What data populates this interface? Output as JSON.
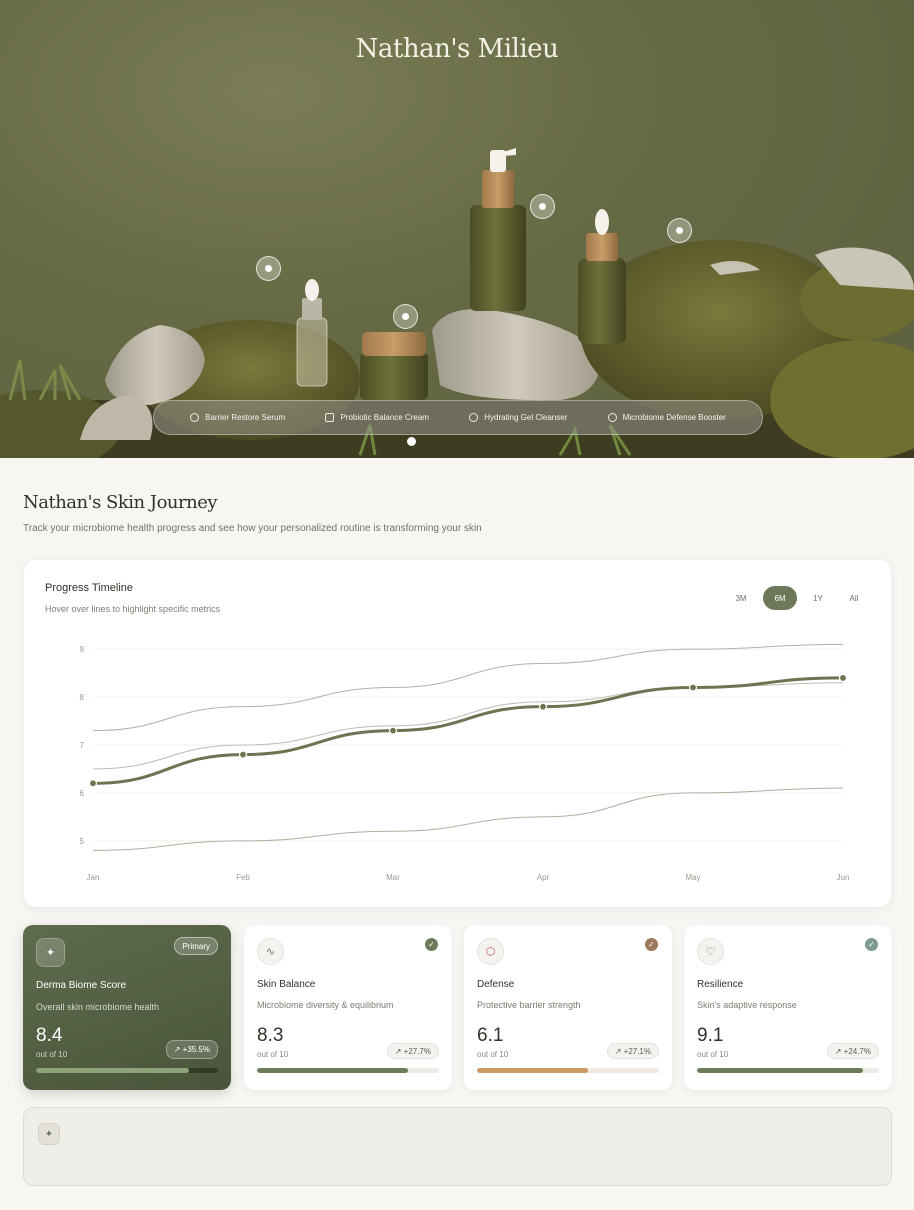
{
  "hero": {
    "brand": "Nathan's Milieu",
    "products": [
      {
        "label": "Barrier Restore Serum",
        "icon": "drops-icon"
      },
      {
        "label": "Probiotic Balance Cream",
        "icon": "jar-icon"
      },
      {
        "label": "Hydrating Gel Cleanser",
        "icon": "droplet-icon"
      },
      {
        "label": "Microbiome Defense Booster",
        "icon": "shield-icon"
      }
    ]
  },
  "journey": {
    "title": "Nathan's Skin Journey",
    "subtitle": "Track your microbiome health progress and see how your personalized routine is transforming your skin"
  },
  "timeline": {
    "title": "Progress Timeline",
    "subtitle": "Hover over lines to highlight specific metrics",
    "ranges": [
      "3M",
      "6M",
      "1Y",
      "All"
    ],
    "active_range": "6M"
  },
  "chart_data": {
    "type": "line",
    "title": "Progress Timeline",
    "x": [
      "Jan",
      "Feb",
      "Mar",
      "Apr",
      "May",
      "Jun"
    ],
    "yticks": [
      5,
      6,
      7,
      8,
      9
    ],
    "ylim": [
      4.6,
      9.4
    ],
    "grid": true,
    "series": [
      {
        "name": "Derma Biome Score",
        "values": [
          6.2,
          6.8,
          7.3,
          7.8,
          8.2,
          8.4
        ],
        "color": "#6b7552",
        "highlight": true
      },
      {
        "name": "Skin Balance",
        "values": [
          6.5,
          7.0,
          7.4,
          7.9,
          8.2,
          8.3
        ],
        "color": "#b9bdb2"
      },
      {
        "name": "Resilience",
        "values": [
          7.3,
          7.8,
          8.2,
          8.7,
          9.0,
          9.1
        ],
        "color": "#a8b4b2"
      },
      {
        "name": "Defense",
        "values": [
          4.8,
          5.0,
          5.2,
          5.5,
          6.0,
          6.1
        ],
        "color": "#b2ad9c"
      }
    ]
  },
  "metrics": [
    {
      "name": "Derma Biome Score",
      "desc": "Overall skin microbiome health",
      "value": "8.4",
      "out_of": "out of 10",
      "change": "+35.5%",
      "badge": "Primary",
      "icon": "sparkle-icon",
      "fill": 0.84,
      "fill_color": "#8fa37a",
      "primary": true
    },
    {
      "name": "Skin Balance",
      "desc": "Microbiome diversity & equilibrium",
      "value": "8.3",
      "out_of": "out of 10",
      "change": "+27.7%",
      "icon": "pulse-icon",
      "fill": 0.83,
      "fill_color": "#6d7b57",
      "check_color": "#6e7a5c"
    },
    {
      "name": "Defense",
      "desc": "Protective barrier strength",
      "value": "6.1",
      "out_of": "out of 10",
      "change": "+27.1%",
      "icon": "shield-icon",
      "fill": 0.61,
      "fill_color": "#c99a63",
      "check_color": "#9b7a5c",
      "icon_color": "#b5564a"
    },
    {
      "name": "Resilience",
      "desc": "Skin's adaptive response",
      "value": "9.1",
      "out_of": "out of 10",
      "change": "+24.7%",
      "icon": "heart-icon",
      "fill": 0.91,
      "fill_color": "#6d7b57",
      "check_color": "#7f9a92"
    }
  ],
  "bottom_panel": {
    "icon": "sparkle-icon"
  }
}
